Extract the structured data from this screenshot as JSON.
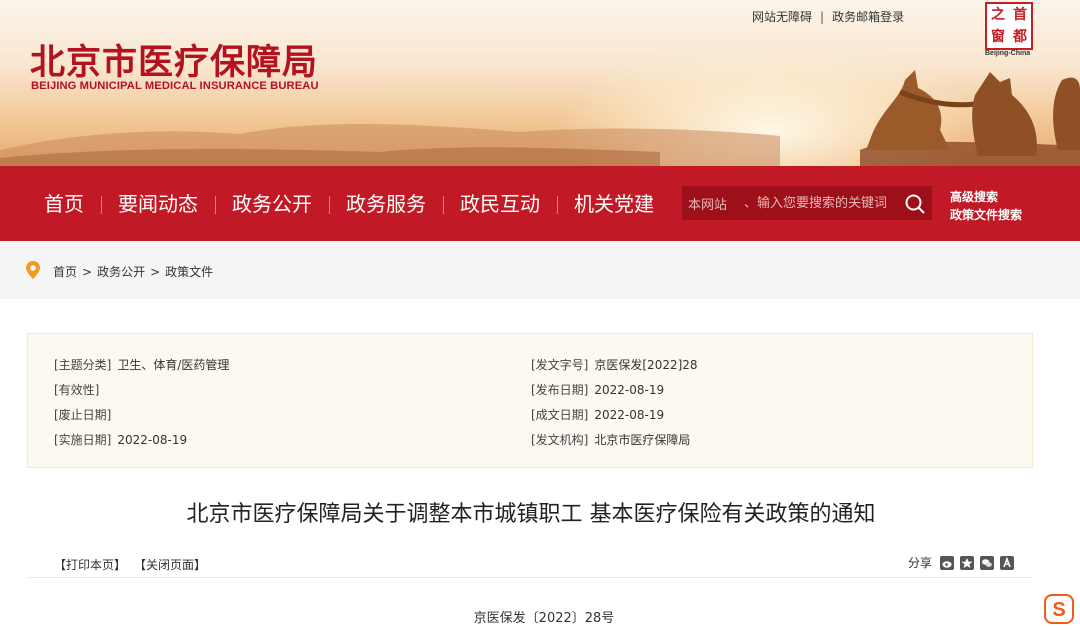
{
  "header": {
    "logo_cn": "北京市医疗保障局",
    "logo_en": "BEIJING MUNICIPAL MEDICAL INSURANCE BUREAU",
    "top_links": [
      "网站无障碍",
      "政务邮箱登录"
    ],
    "top_sep": "|",
    "seal_chars": [
      "之",
      "首",
      "窗",
      "都"
    ],
    "seal_caption": "Beijing-China"
  },
  "nav": {
    "items": [
      "首页",
      "要闻动态",
      "政务公开",
      "政务服务",
      "政民互动",
      "机关党建"
    ],
    "search_scope": "本网站",
    "search_placeholder": "、输入您要搜索的关键词",
    "advanced": [
      "高级搜索",
      "政策文件搜索"
    ]
  },
  "breadcrumb": [
    "首页",
    "政务公开",
    "政策文件"
  ],
  "breadcrumb_sep": ">",
  "meta": {
    "left": [
      {
        "label": "[主题分类]",
        "value": "卫生、体育/医药管理"
      },
      {
        "label": "[有效性]",
        "value": ""
      },
      {
        "label": "[废止日期]",
        "value": ""
      },
      {
        "label": "[实施日期]",
        "value": "2022-08-19"
      }
    ],
    "right": [
      {
        "label": "[发文字号]",
        "value": "京医保发[2022]28"
      },
      {
        "label": "[发布日期]",
        "value": "2022-08-19"
      },
      {
        "label": "[成文日期]",
        "value": "2022-08-19"
      },
      {
        "label": "[发文机构]",
        "value": "北京市医疗保障局"
      }
    ]
  },
  "article": {
    "title": "北京市医疗保障局关于调整本市城镇职工 基本医疗保险有关政策的通知",
    "print_label": "【打印本页】",
    "close_label": "【关闭页面】",
    "share_label": "分享",
    "share_icons": [
      "weibo-icon",
      "qzone-icon",
      "wechat-icon",
      "renren-icon"
    ],
    "doc_number": "京医保发〔2022〕28号"
  },
  "colors": {
    "brand_red": "#c11a26",
    "search_bg": "#9e1019",
    "meta_bg": "#fdf8f0"
  }
}
